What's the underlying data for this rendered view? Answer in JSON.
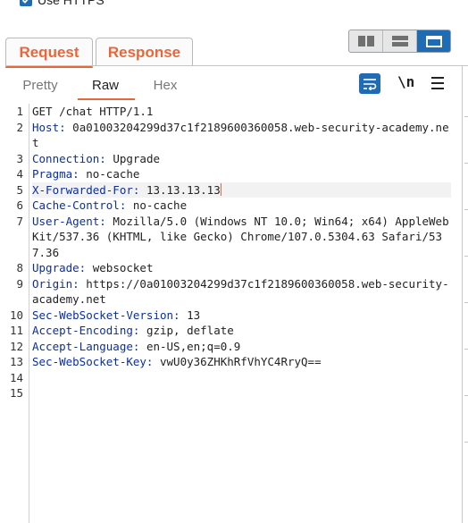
{
  "top_option": {
    "label": "Use HTTPS",
    "checked": true
  },
  "tabs": [
    {
      "label": "Request",
      "active": true
    },
    {
      "label": "Response",
      "active": false
    }
  ],
  "view_modes": [
    {
      "name": "split-horizontal-icon"
    },
    {
      "name": "split-vertical-icon"
    },
    {
      "name": "single-pane-icon",
      "active": true
    }
  ],
  "subtabs": {
    "pretty": "Pretty",
    "raw": "Raw",
    "hex": "Hex",
    "active": "Raw"
  },
  "toolbar": {
    "wrap_icon": "word-wrap-icon",
    "newline_label": "\\n",
    "menu_icon": "menu-icon"
  },
  "colors": {
    "accent": "#e8673a",
    "blue": "#1f6cb4",
    "header_key": "#0b2f9e"
  },
  "lines": [
    {
      "n": "1",
      "key": "",
      "value": "GET /chat HTTP/1.1"
    },
    {
      "n": "2",
      "key": "Host:",
      "value": " 0a01003204299d37c1f2189600360058.web-security-academy.net"
    },
    {
      "n": "3",
      "key": "Connection:",
      "value": " Upgrade"
    },
    {
      "n": "4",
      "key": "Pragma:",
      "value": " no-cache"
    },
    {
      "n": "5",
      "key": "X-Forwarded-For:",
      "value": " 13.13.13.13",
      "active": true
    },
    {
      "n": "6",
      "key": "Cache-Control:",
      "value": " no-cache"
    },
    {
      "n": "7",
      "key": "User-Agent:",
      "value": " Mozilla/5.0 (Windows NT 10.0; Win64; x64) AppleWebKit/537.36 (KHTML, like Gecko) Chrome/107.0.5304.63 Safari/537.36"
    },
    {
      "n": "8",
      "key": "Upgrade:",
      "value": " websocket"
    },
    {
      "n": "9",
      "key": "Origin:",
      "value": " https://0a01003204299d37c1f2189600360058.web-security-academy.net"
    },
    {
      "n": "10",
      "key": "Sec-WebSocket-Version:",
      "value": " 13"
    },
    {
      "n": "11",
      "key": "Accept-Encoding:",
      "value": " gzip, deflate"
    },
    {
      "n": "12",
      "key": "Accept-Language:",
      "value": " en-US,en;q=0.9"
    },
    {
      "n": "13",
      "key": "Sec-WebSocket-Key:",
      "value": " vwU0y36ZHKhRfVhYC4RryQ=="
    },
    {
      "n": "14",
      "key": "",
      "value": ""
    },
    {
      "n": "15",
      "key": "",
      "value": ""
    }
  ]
}
